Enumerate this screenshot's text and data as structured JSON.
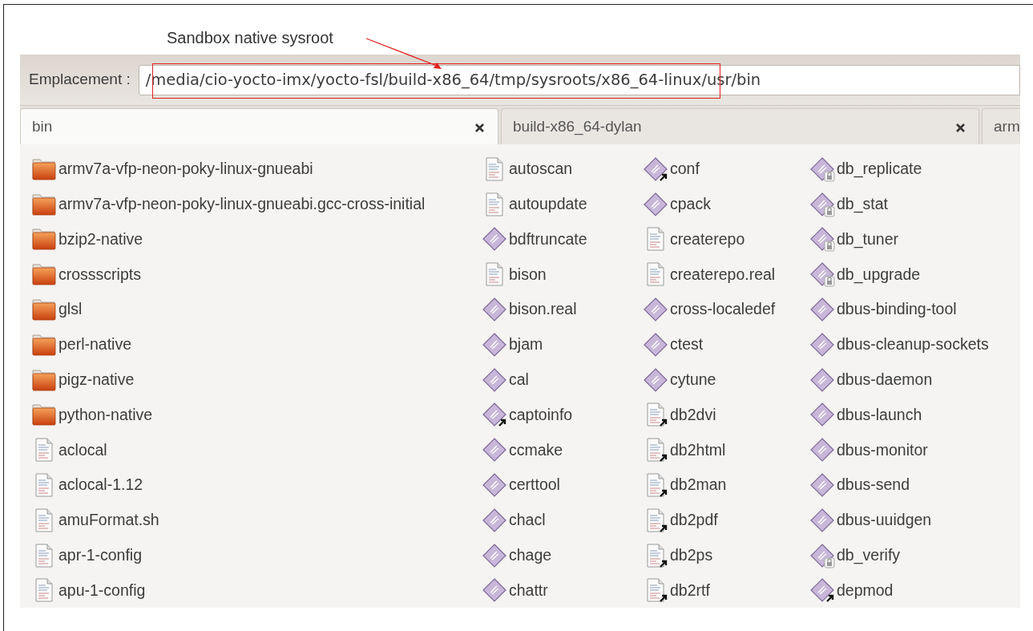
{
  "annotation": {
    "text": "Sandbox native sysroot"
  },
  "location": {
    "label": "Emplacement :",
    "path": "/media/cio-yocto-imx/yocto-fsl/build-x86_64/tmp/sysroots/x86_64-linux/usr/bin"
  },
  "tabs": [
    {
      "label": "bin",
      "selected": true,
      "closable": true
    },
    {
      "label": "build-x86_64-dylan",
      "selected": false,
      "closable": true
    },
    {
      "label": "arm",
      "selected": false,
      "closable": false
    }
  ],
  "columns": [
    {
      "items": [
        {
          "name": "armv7a-vfp-neon-poky-linux-gnueabi",
          "kind": "folder",
          "link": false,
          "locked": false
        },
        {
          "name": "armv7a-vfp-neon-poky-linux-gnueabi.gcc-cross-initial",
          "kind": "folder",
          "link": false,
          "locked": false
        },
        {
          "name": "bzip2-native",
          "kind": "folder",
          "link": false,
          "locked": false
        },
        {
          "name": "crossscripts",
          "kind": "folder",
          "link": false,
          "locked": false
        },
        {
          "name": "glsl",
          "kind": "folder",
          "link": false,
          "locked": false
        },
        {
          "name": "perl-native",
          "kind": "folder",
          "link": false,
          "locked": false
        },
        {
          "name": "pigz-native",
          "kind": "folder",
          "link": false,
          "locked": false
        },
        {
          "name": "python-native",
          "kind": "folder",
          "link": false,
          "locked": false
        },
        {
          "name": "aclocal",
          "kind": "text",
          "link": false,
          "locked": false
        },
        {
          "name": "aclocal-1.12",
          "kind": "text",
          "link": false,
          "locked": false
        },
        {
          "name": "amuFormat.sh",
          "kind": "text",
          "link": false,
          "locked": false
        },
        {
          "name": "apr-1-config",
          "kind": "text",
          "link": false,
          "locked": false
        },
        {
          "name": "apu-1-config",
          "kind": "text",
          "link": false,
          "locked": false
        }
      ]
    },
    {
      "items": [
        {
          "name": "autoscan",
          "kind": "text",
          "link": false,
          "locked": false
        },
        {
          "name": "autoupdate",
          "kind": "text",
          "link": false,
          "locked": false
        },
        {
          "name": "bdftruncate",
          "kind": "exec",
          "link": false,
          "locked": false
        },
        {
          "name": "bison",
          "kind": "text",
          "link": false,
          "locked": false
        },
        {
          "name": "bison.real",
          "kind": "exec",
          "link": false,
          "locked": false
        },
        {
          "name": "bjam",
          "kind": "exec",
          "link": false,
          "locked": false
        },
        {
          "name": "cal",
          "kind": "exec",
          "link": false,
          "locked": false
        },
        {
          "name": "captoinfo",
          "kind": "exec",
          "link": true,
          "locked": false
        },
        {
          "name": "ccmake",
          "kind": "exec",
          "link": false,
          "locked": false
        },
        {
          "name": "certtool",
          "kind": "exec",
          "link": false,
          "locked": false
        },
        {
          "name": "chacl",
          "kind": "exec",
          "link": false,
          "locked": false
        },
        {
          "name": "chage",
          "kind": "exec",
          "link": false,
          "locked": false
        },
        {
          "name": "chattr",
          "kind": "exec",
          "link": false,
          "locked": false
        }
      ]
    },
    {
      "items": [
        {
          "name": "conf",
          "kind": "exec",
          "link": true,
          "locked": false
        },
        {
          "name": "cpack",
          "kind": "exec",
          "link": false,
          "locked": false
        },
        {
          "name": "createrepo",
          "kind": "text",
          "link": false,
          "locked": false
        },
        {
          "name": "createrepo.real",
          "kind": "text",
          "link": false,
          "locked": false
        },
        {
          "name": "cross-localedef",
          "kind": "exec",
          "link": false,
          "locked": false
        },
        {
          "name": "ctest",
          "kind": "exec",
          "link": false,
          "locked": false
        },
        {
          "name": "cytune",
          "kind": "exec",
          "link": false,
          "locked": false
        },
        {
          "name": "db2dvi",
          "kind": "text",
          "link": true,
          "locked": false
        },
        {
          "name": "db2html",
          "kind": "text",
          "link": true,
          "locked": false
        },
        {
          "name": "db2man",
          "kind": "text",
          "link": true,
          "locked": false
        },
        {
          "name": "db2pdf",
          "kind": "text",
          "link": true,
          "locked": false
        },
        {
          "name": "db2ps",
          "kind": "text",
          "link": true,
          "locked": false
        },
        {
          "name": "db2rtf",
          "kind": "text",
          "link": true,
          "locked": false
        }
      ]
    },
    {
      "items": [
        {
          "name": "db_replicate",
          "kind": "exec",
          "link": false,
          "locked": true
        },
        {
          "name": "db_stat",
          "kind": "exec",
          "link": false,
          "locked": true
        },
        {
          "name": "db_tuner",
          "kind": "exec",
          "link": false,
          "locked": true
        },
        {
          "name": "db_upgrade",
          "kind": "exec",
          "link": false,
          "locked": true
        },
        {
          "name": "dbus-binding-tool",
          "kind": "exec",
          "link": false,
          "locked": false
        },
        {
          "name": "dbus-cleanup-sockets",
          "kind": "exec",
          "link": false,
          "locked": false
        },
        {
          "name": "dbus-daemon",
          "kind": "exec",
          "link": false,
          "locked": false
        },
        {
          "name": "dbus-launch",
          "kind": "exec",
          "link": false,
          "locked": false
        },
        {
          "name": "dbus-monitor",
          "kind": "exec",
          "link": false,
          "locked": false
        },
        {
          "name": "dbus-send",
          "kind": "exec",
          "link": false,
          "locked": false
        },
        {
          "name": "dbus-uuidgen",
          "kind": "exec",
          "link": false,
          "locked": false
        },
        {
          "name": "db_verify",
          "kind": "exec",
          "link": false,
          "locked": true
        },
        {
          "name": "depmod",
          "kind": "exec",
          "link": true,
          "locked": false
        }
      ]
    }
  ]
}
